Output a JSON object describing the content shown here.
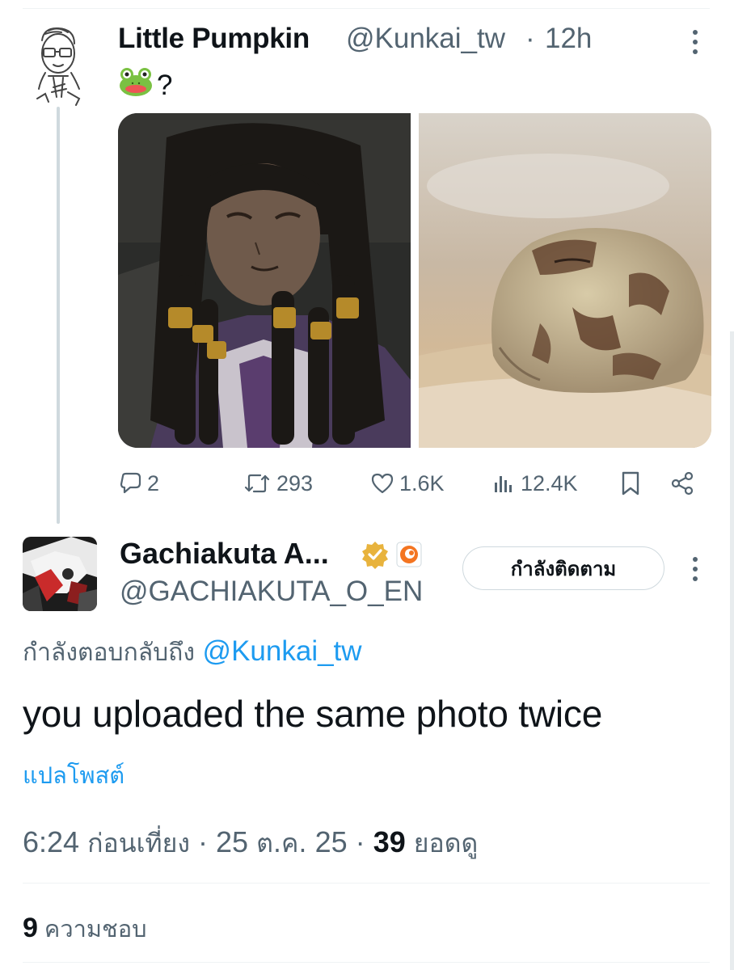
{
  "original_post": {
    "display_name": "Little Pumpkin",
    "handle": "@Kunkai_tw",
    "separator": "·",
    "time": "12h",
    "emoji": "frog-face",
    "text": "?",
    "media": [
      {
        "alt": "anime character with long dreadlocks"
      },
      {
        "alt": "desert rain frog on sand"
      }
    ],
    "actions": {
      "replies": "2",
      "reposts": "293",
      "likes": "1.6K",
      "views": "12.4K"
    }
  },
  "reply": {
    "display_name": "Gachiakuta A...",
    "handle": "@GACHIAKUTA_O_EN",
    "follow_label": "กำลังติดตาม",
    "replying_to_label": "กำลังตอบกลับถึง",
    "replying_to_handle": "@Kunkai_tw",
    "text": "you uploaded the same photo twice",
    "translate_label": "แปลโพสต์",
    "time": "6:24",
    "time_period": "ก่อนเที่ยง",
    "dot": "·",
    "date_num1": "25",
    "date_month": "ต.ค.",
    "date_num2": "25",
    "views_count": "39",
    "views_label": "ยอดดู",
    "likes_count": "9",
    "likes_label": "ความชอบ"
  },
  "colors": {
    "text_primary": "#0f1419",
    "text_secondary": "#536471",
    "accent": "#1d9bf0",
    "verified_gold": "#e8b33d",
    "border": "#cfd9de"
  }
}
